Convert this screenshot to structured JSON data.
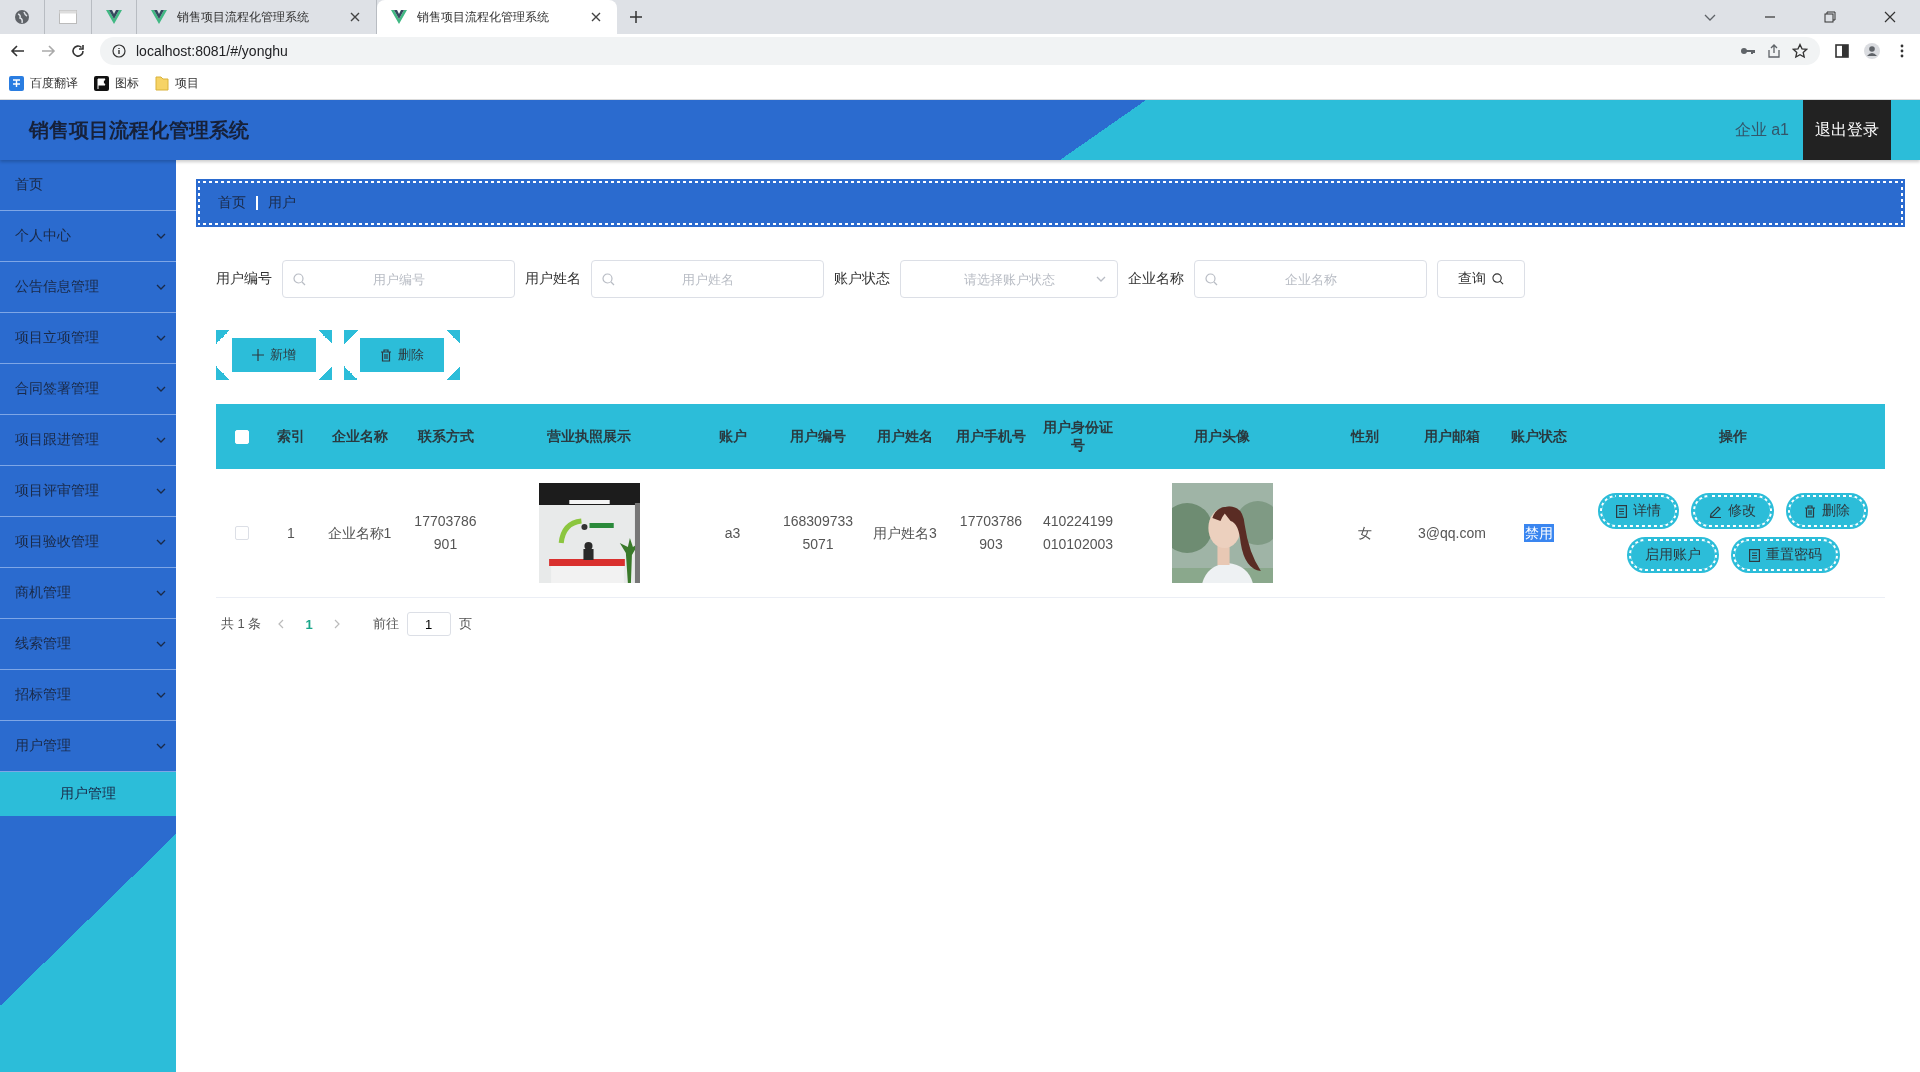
{
  "browser": {
    "tabs": [
      {
        "kind": "globe",
        "selected": false
      },
      {
        "kind": "page",
        "selected": false
      },
      {
        "kind": "app",
        "selected": false
      },
      {
        "kind": "app",
        "title": "销售项目流程化管理系统",
        "selected": false
      },
      {
        "kind": "app",
        "title": "销售项目流程化管理系统",
        "selected": true
      }
    ],
    "url": "localhost:8081/#/yonghu",
    "bookmarks": [
      {
        "kind": "translate",
        "label": "百度翻译"
      },
      {
        "kind": "flag",
        "label": "图标"
      },
      {
        "kind": "folder",
        "label": "项目"
      }
    ]
  },
  "header": {
    "title": "销售项目流程化管理系统",
    "user": "企业 a1",
    "logout": "退出登录"
  },
  "sidebar": {
    "items": [
      {
        "kind": "link",
        "label": "首页",
        "selected": false
      },
      {
        "kind": "menu",
        "label": "个人中心",
        "selected": false
      },
      {
        "kind": "menu",
        "label": "公告信息管理",
        "selected": false
      },
      {
        "kind": "menu",
        "label": "项目立项管理",
        "selected": false
      },
      {
        "kind": "menu",
        "label": "合同签署管理",
        "selected": false
      },
      {
        "kind": "menu",
        "label": "项目跟进管理",
        "selected": false
      },
      {
        "kind": "menu",
        "label": "项目评审管理",
        "selected": false
      },
      {
        "kind": "menu",
        "label": "项目验收管理",
        "selected": false
      },
      {
        "kind": "menu",
        "label": "商机管理",
        "selected": false
      },
      {
        "kind": "menu",
        "label": "线索管理",
        "selected": false
      },
      {
        "kind": "menu",
        "label": "招标管理",
        "selected": false
      },
      {
        "kind": "menu",
        "label": "用户管理",
        "selected": false,
        "children": [
          {
            "label": "用户管理",
            "selected": true
          }
        ]
      }
    ]
  },
  "breadcrumb": [
    "首页",
    "用户"
  ],
  "filters": [
    {
      "kind": "input",
      "label": "用户编号",
      "placeholder": "用户编号"
    },
    {
      "kind": "input",
      "label": "用户姓名",
      "placeholder": "用户姓名"
    },
    {
      "kind": "select",
      "label": "账户状态",
      "placeholder": "请选择账户状态"
    },
    {
      "kind": "input",
      "label": "企业名称",
      "placeholder": "企业名称"
    }
  ],
  "search_button": "查询",
  "actions": [
    {
      "kind": "add",
      "label": "新增"
    },
    {
      "kind": "delete",
      "label": "删除"
    }
  ],
  "table": {
    "select_all": {
      "checked": false
    },
    "columns": [
      "索引",
      "企业名称",
      "联系方式",
      "营业执照展示",
      "账户",
      "用户编号",
      "用户姓名",
      "用户手机号",
      "用户身份证号",
      "用户头像",
      "性别",
      "用户邮箱",
      "账户状态",
      "操作"
    ],
    "rows": [
      {
        "checked": false,
        "cells": [
          {
            "kind": "text",
            "text": "1"
          },
          {
            "kind": "text",
            "text": "企业名称1"
          },
          {
            "kind": "text",
            "text": "17703786901"
          },
          {
            "kind": "picture"
          },
          {
            "kind": "text",
            "text": "a3"
          },
          {
            "kind": "text",
            "text": "1683097335071"
          },
          {
            "kind": "text",
            "text": "用户姓名3"
          },
          {
            "kind": "text",
            "text": "17703786903"
          },
          {
            "kind": "text",
            "text": "410224199010102003"
          },
          {
            "kind": "picture"
          },
          {
            "kind": "text",
            "text": "女"
          },
          {
            "kind": "text",
            "text": "3@qq.com"
          },
          {
            "kind": "status",
            "text": "禁用"
          },
          {
            "kind": "actions",
            "buttons": [
              {
                "kind": "detail",
                "label": "详情"
              },
              {
                "kind": "edit",
                "label": "修改"
              },
              {
                "kind": "delete",
                "label": "删除"
              },
              {
                "kind": "plain",
                "label": "启用账户"
              },
              {
                "kind": "reset",
                "label": "重置密码"
              }
            ]
          }
        ]
      }
    ]
  },
  "pagination": {
    "total": "共 1 条",
    "pages": [
      {
        "label": "1",
        "selected": true
      }
    ],
    "goto_label": "前往",
    "goto_value": "1",
    "page_suffix": "页"
  }
}
